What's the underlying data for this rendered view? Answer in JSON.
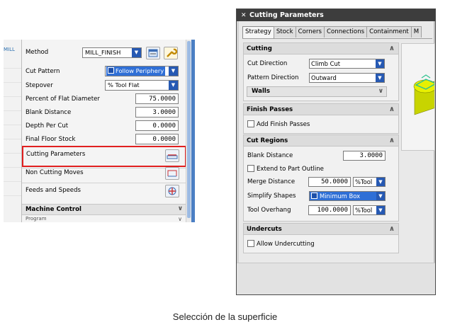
{
  "left_panel": {
    "edge_stub_text": "MILL",
    "method": {
      "label": "Method",
      "value": "MILL_FINISH"
    },
    "cut_pattern": {
      "label": "Cut Pattern",
      "value": "Follow Periphery"
    },
    "stepover": {
      "label": "Stepover",
      "value": "% Tool Flat"
    },
    "percent_flat": {
      "label": "Percent of Flat Diameter",
      "value": "75.0000"
    },
    "blank_distance": {
      "label": "Blank Distance",
      "value": "3.0000"
    },
    "depth_per_cut": {
      "label": "Depth Per Cut",
      "value": "0.0000"
    },
    "final_floor_stock": {
      "label": "Final Floor Stock",
      "value": "0.0000"
    },
    "cutting_parameters_label": "Cutting Parameters",
    "non_cutting_moves_label": "Non Cutting Moves",
    "feeds_and_speeds_label": "Feeds and Speeds",
    "machine_control_label": "Machine Control",
    "program_stub": "Program"
  },
  "dialog": {
    "title": "Cutting Parameters",
    "tabs": [
      "Strategy",
      "Stock",
      "Corners",
      "Connections",
      "Containment",
      "M"
    ],
    "active_tab": "Strategy",
    "cutting": {
      "header": "Cutting",
      "cut_direction": {
        "label": "Cut Direction",
        "value": "Climb Cut"
      },
      "pattern_direction": {
        "label": "Pattern Direction",
        "value": "Outward"
      },
      "walls_label": "Walls"
    },
    "finish_passes": {
      "header": "Finish Passes",
      "add_finish_passes": "Add Finish Passes"
    },
    "cut_regions": {
      "header": "Cut Regions",
      "blank_distance": {
        "label": "Blank Distance",
        "value": "3.0000"
      },
      "extend_to_part_outline": "Extend to Part Outline",
      "merge_distance": {
        "label": "Merge Distance",
        "value": "50.0000",
        "unit": "%Tool"
      },
      "simplify_shapes": {
        "label": "Simplify Shapes",
        "value": "Minimum Box"
      },
      "tool_overhang": {
        "label": "Tool Overhang",
        "value": "100.0000",
        "unit": "%Tool"
      }
    },
    "undercuts": {
      "header": "Undercuts",
      "allow_undercutting": "Allow Undercutting"
    }
  },
  "caption": "Selección de la superficie",
  "colors": {
    "highlight_red": "#e01f1f",
    "selection_blue": "#2f6fd6",
    "title_bar": "#3d3d3d",
    "preview_part": "#c8d400",
    "preview_top": "#2ec28f"
  }
}
